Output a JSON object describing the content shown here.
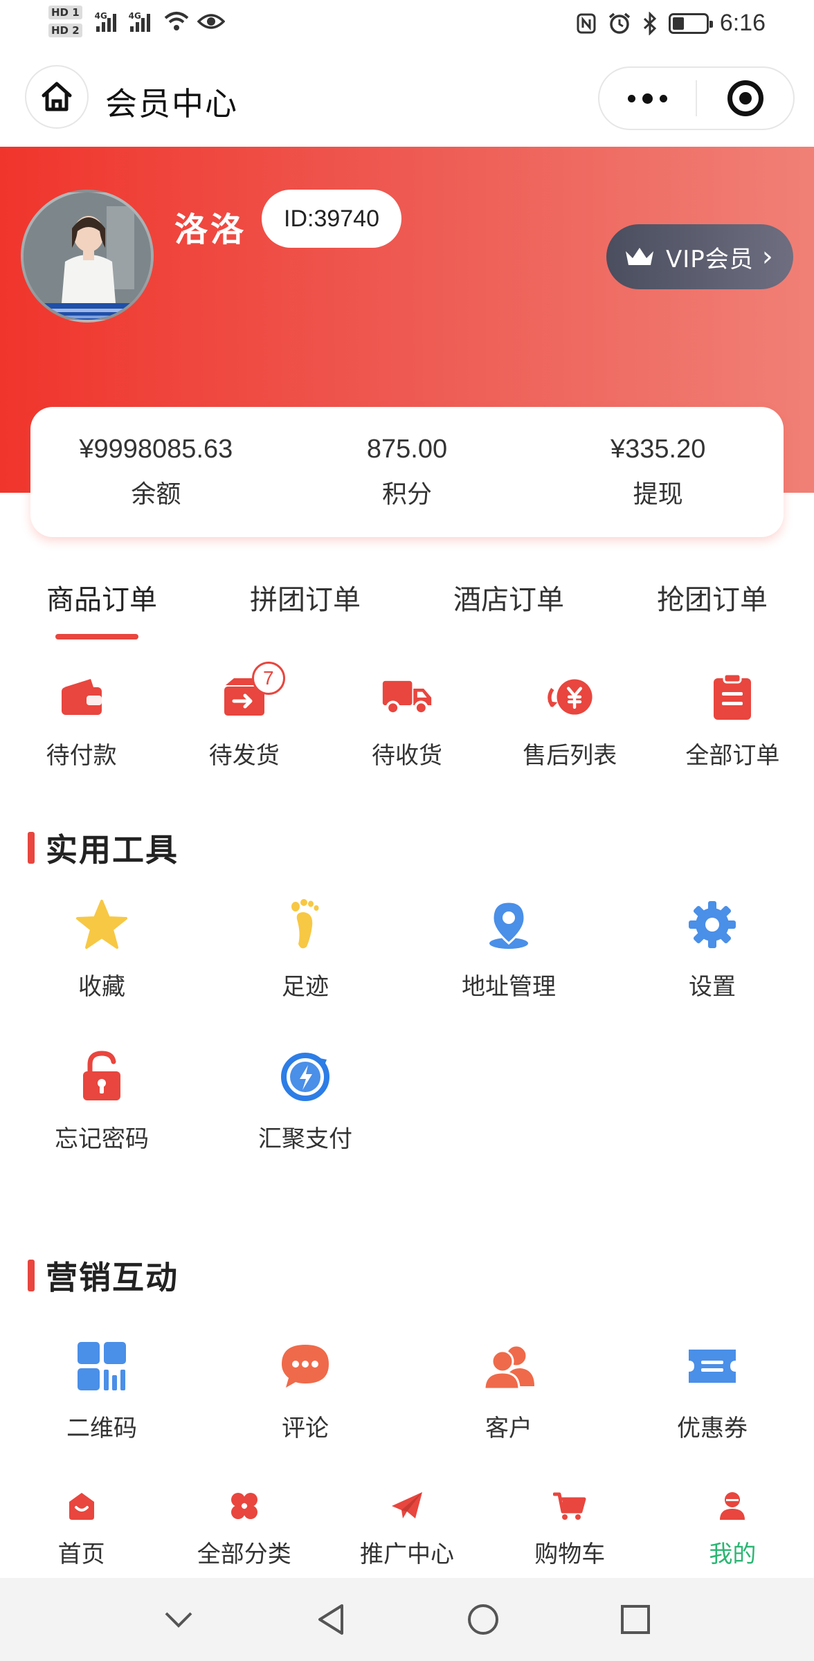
{
  "status_bar": {
    "time": "6:16",
    "hd1": "HD 1",
    "hd2": "HD 2",
    "net1": "4G",
    "net2": "4G",
    "battery_level": 0.35
  },
  "navbar": {
    "title": "会员中心"
  },
  "user": {
    "name": "洛洛",
    "id_label": "ID:39740",
    "vip_label": "VIP会员"
  },
  "assets": [
    {
      "value": "¥9998085.63",
      "label": "余额"
    },
    {
      "value": "875.00",
      "label": "积分"
    },
    {
      "value": "¥335.20",
      "label": "提现"
    }
  ],
  "order_tabs": [
    {
      "label": "商品订单",
      "active": true
    },
    {
      "label": "拼团订单",
      "active": false
    },
    {
      "label": "酒店订单",
      "active": false
    },
    {
      "label": "抢团订单",
      "active": false
    }
  ],
  "order_status": [
    {
      "label": "待付款",
      "icon": "wallet-icon"
    },
    {
      "label": "待发货",
      "icon": "box-arrow-icon",
      "badge": "7"
    },
    {
      "label": "待收货",
      "icon": "truck-icon"
    },
    {
      "label": "售后列表",
      "icon": "refund-yen-icon"
    },
    {
      "label": "全部订单",
      "icon": "clipboard-icon"
    }
  ],
  "tools_section": {
    "title": "实用工具",
    "items": [
      {
        "label": "收藏",
        "icon": "star-icon"
      },
      {
        "label": "足迹",
        "icon": "footprint-icon"
      },
      {
        "label": "地址管理",
        "icon": "location-pin-icon"
      },
      {
        "label": "设置",
        "icon": "gear-icon"
      },
      {
        "label": "忘记密码",
        "icon": "unlock-icon"
      },
      {
        "label": "汇聚支付",
        "icon": "payment-refresh-icon"
      }
    ]
  },
  "marketing_section": {
    "title": "营销互动",
    "items": [
      {
        "label": "二维码",
        "icon": "qrcode-icon"
      },
      {
        "label": "评论",
        "icon": "comment-bubble-icon"
      },
      {
        "label": "客户",
        "icon": "customers-icon"
      },
      {
        "label": "优惠券",
        "icon": "coupon-icon"
      }
    ]
  },
  "tabbar": [
    {
      "label": "首页",
      "icon": "home-bag-icon",
      "active": false
    },
    {
      "label": "全部分类",
      "icon": "category-petals-icon",
      "active": false
    },
    {
      "label": "推广中心",
      "icon": "paper-plane-icon",
      "active": false
    },
    {
      "label": "购物车",
      "icon": "cart-icon",
      "active": false
    },
    {
      "label": "我的",
      "icon": "user-icon",
      "active": true
    }
  ],
  "colors": {
    "accent_red": "#e8463e",
    "active_green": "#2bb673",
    "tool_yellow": "#f7c844",
    "tool_blue": "#4a8fe8"
  }
}
